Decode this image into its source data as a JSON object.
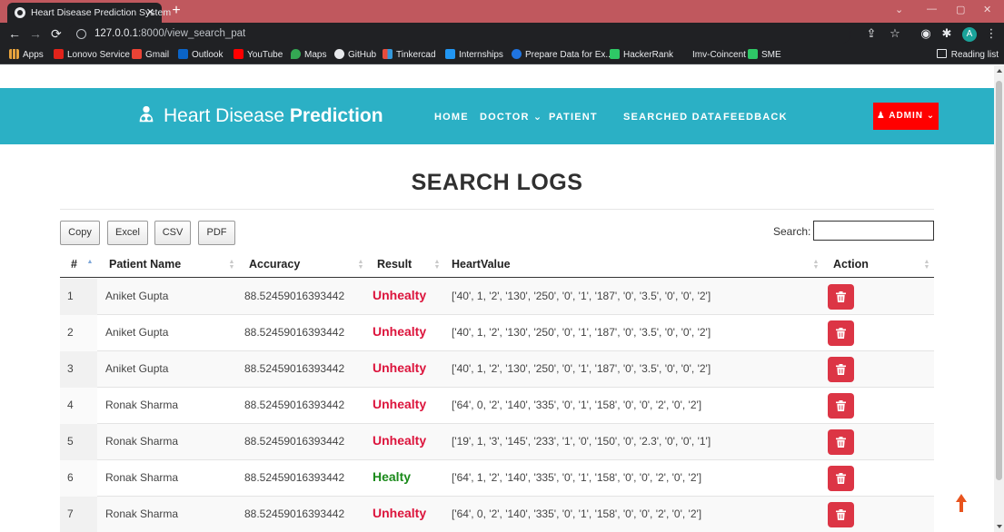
{
  "browser": {
    "tab_title": "Heart Disease Prediction System",
    "tab_close": "✕",
    "new_tab": "+",
    "url_host": "127.0.0.1",
    "url_rest": ":8000/view_search_pat",
    "bookmarks": [
      "Apps",
      "Lonovo Service",
      "Gmail",
      "Outlook",
      "YouTube",
      "Maps",
      "GitHub",
      "Tinkercad",
      "Internships",
      "Prepare Data for Ex...",
      "HackerRank",
      "Imv-Coincent",
      "SME"
    ],
    "reading_list": "Reading list",
    "avatar_letter": "A"
  },
  "site": {
    "brand_light": "Heart Disease ",
    "brand_bold": "Prediction",
    "nav": [
      "HOME",
      "DOCTOR ⌄",
      "PATIENT",
      "SEARCHED DATA",
      "FEEDBACK"
    ],
    "admin_label": "♟ ADMIN ⌄",
    "accent_color": "#2bb0c5",
    "admin_color": "#ff0000"
  },
  "page": {
    "title": "SEARCH LOGS",
    "buttons": [
      "Copy",
      "Excel",
      "CSV",
      "PDF"
    ],
    "search_label": "Search:",
    "search_value": "",
    "columns": [
      "#",
      "Patient Name",
      "Accuracy",
      "Result",
      "HeartValue",
      "Action"
    ],
    "rows": [
      {
        "num": "1",
        "name": "Aniket Gupta",
        "accuracy": "88.52459016393442",
        "result": "Unhealty",
        "status": "bad",
        "heart": "['40', 1, '2', '130', '250', '0', '1', '187', '0', '3.5', '0', '0', '2']"
      },
      {
        "num": "2",
        "name": "Aniket Gupta",
        "accuracy": "88.52459016393442",
        "result": "Unhealty",
        "status": "bad",
        "heart": "['40', 1, '2', '130', '250', '0', '1', '187', '0', '3.5', '0', '0', '2']"
      },
      {
        "num": "3",
        "name": "Aniket Gupta",
        "accuracy": "88.52459016393442",
        "result": "Unhealty",
        "status": "bad",
        "heart": "['40', 1, '2', '130', '250', '0', '1', '187', '0', '3.5', '0', '0', '2']"
      },
      {
        "num": "4",
        "name": "Ronak Sharma",
        "accuracy": "88.52459016393442",
        "result": "Unhealty",
        "status": "bad",
        "heart": "['64', 0, '2', '140', '335', '0', '1', '158', '0', '0', '2', '0', '2']"
      },
      {
        "num": "5",
        "name": "Ronak Sharma",
        "accuracy": "88.52459016393442",
        "result": "Unhealty",
        "status": "bad",
        "heart": "['19', 1, '3', '145', '233', '1', '0', '150', '0', '2.3', '0', '0', '1']"
      },
      {
        "num": "6",
        "name": "Ronak Sharma",
        "accuracy": "88.52459016393442",
        "result": "Healty",
        "status": "good",
        "heart": "['64', 1, '2', '140', '335', '0', '1', '158', '0', '0', '2', '0', '2']"
      },
      {
        "num": "7",
        "name": "Ronak Sharma",
        "accuracy": "88.52459016393442",
        "result": "Unhealty",
        "status": "bad",
        "heart": "['64', 0, '2', '140', '335', '0', '1', '158', '0', '0', '2', '0', '2']"
      }
    ]
  }
}
